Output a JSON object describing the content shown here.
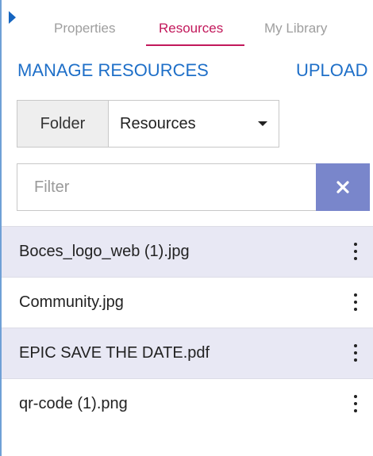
{
  "tabs": [
    {
      "label": "Properties",
      "active": false
    },
    {
      "label": "Resources",
      "active": true
    },
    {
      "label": "My Library",
      "active": false
    }
  ],
  "actions": {
    "manage_label": "MANAGE RESOURCES",
    "upload_label": "UPLOAD"
  },
  "folder": {
    "label": "Folder",
    "selected": "Resources"
  },
  "filter": {
    "placeholder": "Filter",
    "value": ""
  },
  "files": [
    {
      "name": "Boces_logo_web (1).jpg"
    },
    {
      "name": "Community.jpg"
    },
    {
      "name": "EPIC SAVE THE DATE.pdf"
    },
    {
      "name": "qr-code (1).png"
    }
  ],
  "colors": {
    "active_tab": "#c2185b",
    "link": "#1e6fc8",
    "clear_button": "#7986cb",
    "shaded_row": "#e8e8f4"
  },
  "icons": [
    "collapse-triangle-icon",
    "clear-x-icon",
    "caret-down-icon",
    "more-vert-icon"
  ]
}
